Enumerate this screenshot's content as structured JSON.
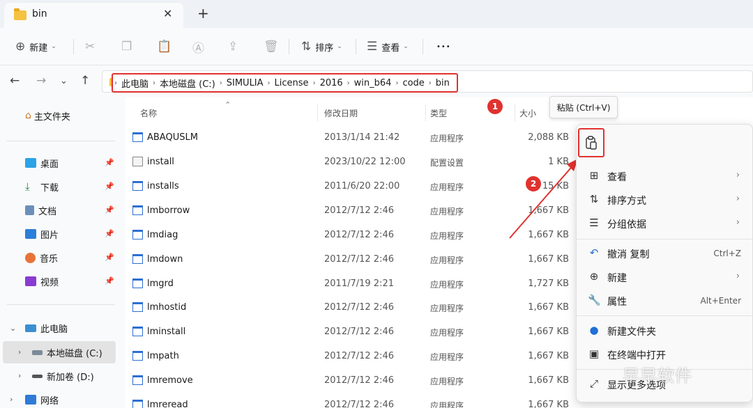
{
  "tab": {
    "title": "bin",
    "close": "✕",
    "new_tab": "+"
  },
  "toolbar": {
    "new_label": "新建",
    "sort_label": "排序",
    "view_label": "查看",
    "more": "•••"
  },
  "address": {
    "crumbs": [
      "此电脑",
      "本地磁盘 (C:)",
      "SIMULIA",
      "License",
      "2016",
      "win_b64",
      "code",
      "bin"
    ]
  },
  "nav_pane": {
    "home": "主文件夹",
    "quick": [
      "桌面",
      "下载",
      "文档",
      "图片",
      "音乐",
      "视频"
    ],
    "this_pc": "此电脑",
    "drive_c": "本地磁盘 (C:)",
    "drive_d": "新加卷 (D:)",
    "network": "网络"
  },
  "columns": {
    "name": "名称",
    "date": "修改日期",
    "type": "类型",
    "size": "大小"
  },
  "files": [
    {
      "name": "ABAQUSLM",
      "date": "2013/1/14 21:42",
      "type": "应用程序",
      "size": "2,088 KB"
    },
    {
      "name": "install",
      "date": "2023/10/22 12:00",
      "type": "配置设置",
      "size": "1 KB"
    },
    {
      "name": "installs",
      "date": "2011/6/20 22:00",
      "type": "应用程序",
      "size": "15 KB"
    },
    {
      "name": "lmborrow",
      "date": "2012/7/12 2:46",
      "type": "应用程序",
      "size": "1,667 KB"
    },
    {
      "name": "lmdiag",
      "date": "2012/7/12 2:46",
      "type": "应用程序",
      "size": "1,667 KB"
    },
    {
      "name": "lmdown",
      "date": "2012/7/12 2:46",
      "type": "应用程序",
      "size": "1,667 KB"
    },
    {
      "name": "lmgrd",
      "date": "2011/7/19 2:21",
      "type": "应用程序",
      "size": "1,727 KB"
    },
    {
      "name": "lmhostid",
      "date": "2012/7/12 2:46",
      "type": "应用程序",
      "size": "1,667 KB"
    },
    {
      "name": "lminstall",
      "date": "2012/7/12 2:46",
      "type": "应用程序",
      "size": "1,667 KB"
    },
    {
      "name": "lmpath",
      "date": "2012/7/12 2:46",
      "type": "应用程序",
      "size": "1,667 KB"
    },
    {
      "name": "lmremove",
      "date": "2012/7/12 2:46",
      "type": "应用程序",
      "size": "1,667 KB"
    },
    {
      "name": "lmreread",
      "date": "2012/7/12 2:46",
      "type": "应用程序",
      "size": "1,667 KB"
    }
  ],
  "tooltip": "粘贴 (Ctrl+V)",
  "context_menu": {
    "view": "查看",
    "sort_by": "排序方式",
    "group_by": "分组依据",
    "undo": "撤消 复制",
    "undo_shortcut": "Ctrl+Z",
    "new": "新建",
    "properties": "属性",
    "properties_shortcut": "Alt+Enter",
    "new_folder": "新建文件夹",
    "open_terminal": "在终端中打开",
    "more_options": "显示更多选项"
  },
  "annotations": {
    "badge1": "1",
    "badge2": "2",
    "accent": "#e0322f"
  },
  "watermark": "早早软件"
}
